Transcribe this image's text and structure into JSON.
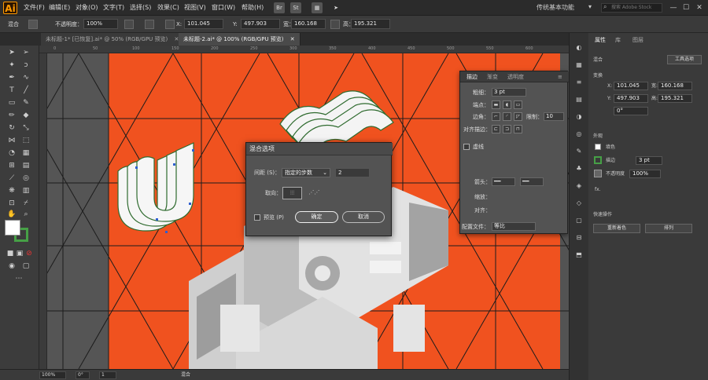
{
  "app": {
    "logo": "Ai",
    "menu": [
      "文件(F)",
      "编辑(E)",
      "对象(O)",
      "文字(T)",
      "选择(S)",
      "效果(C)",
      "视图(V)",
      "窗口(W)",
      "帮助(H)"
    ],
    "bridge_icon": "Br",
    "stock_icon": "St",
    "workspace": "传统基本功能",
    "search_placeholder": "搜索 Adobe Stock"
  },
  "control_bar": {
    "selection": "混合",
    "opacity_label": "不透明度：",
    "opacity_value": "100%",
    "x_label": "X:",
    "x_value": "101.045",
    "y_label": "Y:",
    "y_value": "497.903",
    "w_label": "宽：",
    "w_value": "160.168",
    "h_label": "高：",
    "h_value": "195.321"
  },
  "tabs": [
    {
      "label": "未标题-1* [已恢复].ai* @ 50% (RGB/GPU 预览)",
      "close": "✕"
    },
    {
      "label": "未标题-2.ai* @ 100% (RGB/GPU 预览)",
      "close": "✕"
    }
  ],
  "ruler_numbers": [
    "0",
    "50",
    "100",
    "150",
    "200",
    "250",
    "300",
    "350",
    "400",
    "450",
    "500",
    "550",
    "600"
  ],
  "blend_dialog": {
    "title": "混合选项",
    "spacing_label": "间距 (S)：",
    "spacing_value": "指定的步数",
    "steps_value": "2",
    "orientation_label": "取向：",
    "preview_label": "预览 (P)",
    "ok": "确定",
    "cancel": "取消"
  },
  "stroke_panel": {
    "tabs": [
      "描边",
      "渐变",
      "透明度"
    ],
    "weight_label": "粗细：",
    "weight_value": "3 pt",
    "cap_label": "端点：",
    "corner_label": "边角：",
    "limit_label": "限制：",
    "limit_value": "10",
    "align_label": "对齐描边：",
    "dashed_label": "虚线",
    "arrow_label": "箭头：",
    "scale_label": "缩放：",
    "align_arrow_label": "对齐：",
    "profile_label": "配置文件：",
    "profile_value": "等比"
  },
  "properties": {
    "tabs": [
      "属性",
      "库",
      "图层"
    ],
    "selection": "混合",
    "tool_options": "工具选项",
    "transform_label": "变换",
    "x_label": "X:",
    "x_value": "101.045",
    "y_label": "Y:",
    "y_value": "497.903",
    "w_label": "宽:",
    "w_value": "160.168",
    "h_label": "高:",
    "h_value": "195.321",
    "angle_value": "0°",
    "appearance_label": "外观",
    "fill_label": "填色",
    "stroke_label": "描边",
    "stroke_value": "3 pt",
    "opacity_label": "不透明度",
    "opacity_value": "100%",
    "fx_label": "fx.",
    "quick_actions_label": "快速操作",
    "recolor_btn": "重新着色",
    "arrange_btn": "排列"
  },
  "status_bar": {
    "zoom": "100%",
    "angle": "0°",
    "page": "1",
    "mode": "混合"
  },
  "colors": {
    "artboard": "#f0521f",
    "canvas": "#535353",
    "stroke_green": "#46a046"
  }
}
